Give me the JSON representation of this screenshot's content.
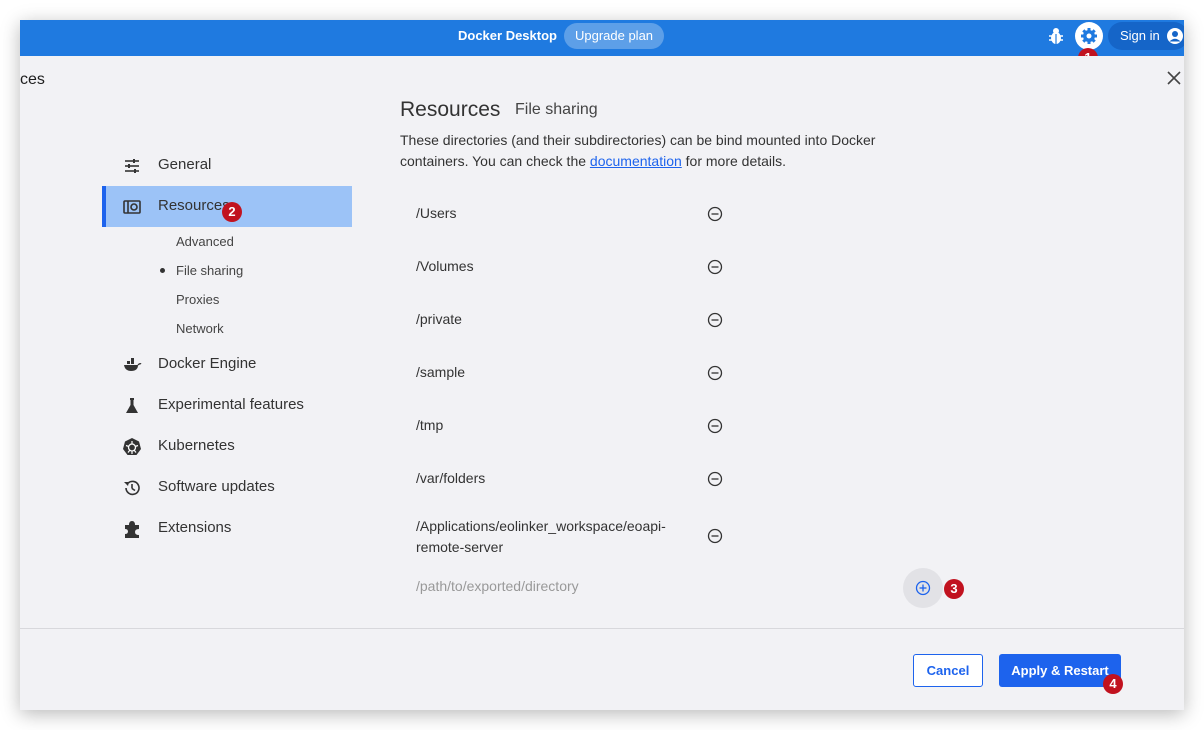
{
  "topbar": {
    "app_title": "Docker Desktop",
    "upgrade_label": "Upgrade plan",
    "signin_label": "Sign in",
    "color": "#1f7ae0",
    "icons": [
      "bug-icon",
      "gear-icon",
      "user-circle-icon"
    ]
  },
  "header": {
    "title": "ces",
    "close_icon": "close-icon"
  },
  "sidebar": {
    "items": [
      {
        "label": "General",
        "icon": "sliders-icon"
      },
      {
        "label": "Resources",
        "icon": "resources-icon",
        "active": true
      },
      {
        "label": "Docker Engine",
        "icon": "whale-icon"
      },
      {
        "label": "Experimental features",
        "icon": "flask-icon"
      },
      {
        "label": "Kubernetes",
        "icon": "kubernetes-icon"
      },
      {
        "label": "Software updates",
        "icon": "history-icon"
      },
      {
        "label": "Extensions",
        "icon": "puzzle-icon"
      }
    ],
    "subitems": [
      {
        "label": "Advanced"
      },
      {
        "label": "File sharing",
        "selected": true
      },
      {
        "label": "Proxies"
      },
      {
        "label": "Network"
      }
    ]
  },
  "main": {
    "heading": "Resources",
    "subheading": "File sharing",
    "description_before": "These directories (and their subdirectories) can be bind mounted into Docker containers. You can check the ",
    "description_link": "documentation",
    "description_after": " for more details.",
    "paths": [
      "/Users",
      "/Volumes",
      "/private",
      "/sample",
      "/tmp",
      "/var/folders",
      "/Applications/eolinker_workspace/eoapi-remote-server"
    ],
    "new_path_placeholder": "/path/to/exported/directory"
  },
  "footer": {
    "cancel_label": "Cancel",
    "apply_label": "Apply & Restart"
  },
  "annotations": [
    "1",
    "2",
    "3",
    "4"
  ],
  "colors": {
    "accent": "#1d63ed",
    "badge": "#c1121f",
    "active_bg": "#9cc3f7"
  }
}
